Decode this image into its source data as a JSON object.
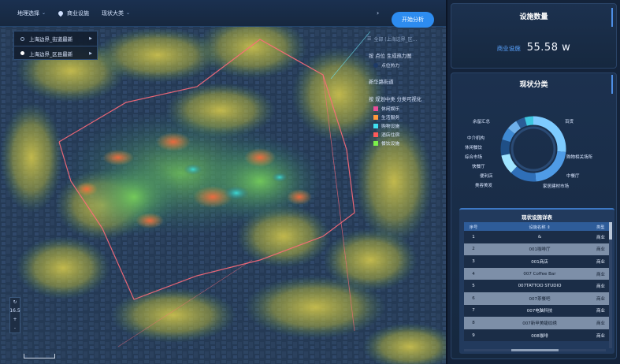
{
  "toolbar": {
    "region_select": "地理选择",
    "poi_type": "商业设施",
    "category": "现状大类",
    "start_button": "开始分析"
  },
  "dropdown": {
    "items": [
      {
        "label": "上海边界_街道最新",
        "selected": false
      },
      {
        "label": "上海边界_区县最新",
        "selected": true
      }
    ]
  },
  "legend": {
    "search_text": "全部 (上海边界_区...",
    "heat_title": "按 点位 生成热力图",
    "heat_item": "点位热力",
    "street_title": "新华路街道",
    "class_title": "按 规划中类 分类可视化",
    "items": [
      {
        "label": "休闲娱乐",
        "color": "#e84f9a"
      },
      {
        "label": "生活服务",
        "color": "#ff9a3c"
      },
      {
        "label": "购物设施",
        "color": "#40e0f0"
      },
      {
        "label": "酒店住宿",
        "color": "#ff5a5a"
      },
      {
        "label": "餐饮设施",
        "color": "#7cf04a"
      }
    ]
  },
  "zoom": {
    "level": "16.5",
    "plus": "+",
    "minus": "-"
  },
  "panel": {
    "count_title": "设施数量",
    "count_label": "商业设施",
    "count_value": "55.58 w",
    "class_title": "现状分类",
    "donut_labels": [
      "余留汇总",
      "中介机构",
      "休闲餐饮",
      "综合市场",
      "快餐厅",
      "便利店",
      "美容美发",
      "百货",
      "购物相关场所",
      "中餐厅",
      "家居建材市场"
    ],
    "table_title": "现状设施详表",
    "table_headers": [
      "序号",
      "设施名称",
      "类型"
    ],
    "table_rows": [
      [
        "1",
        "&",
        "商业"
      ],
      [
        "2",
        "001咖啡厅",
        "商业"
      ],
      [
        "3",
        "001商店",
        "商业"
      ],
      [
        "4",
        "007 Coffee Bar",
        "商业"
      ],
      [
        "5",
        "007TATTOO STUDIO",
        "商业"
      ],
      [
        "6",
        "007茶餐吧",
        "商业"
      ],
      [
        "7",
        "007电脑科技",
        "商业"
      ],
      [
        "8",
        "007新甲美睫纹绣",
        "商业"
      ],
      [
        "9",
        "008咖啡",
        "商业"
      ]
    ]
  },
  "colors": {
    "accent": "#2d8cf0",
    "panel_bg": "#14233a"
  }
}
